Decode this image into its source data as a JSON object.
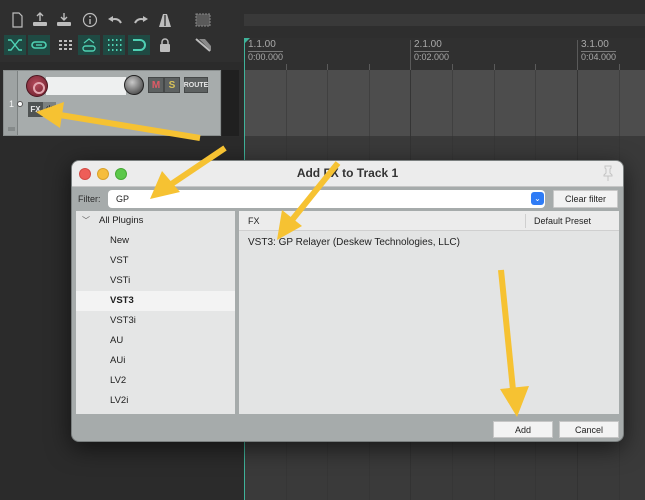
{
  "toolbar": {
    "row1": [
      {
        "icon": "new-project-icon"
      },
      {
        "icon": "save-icon"
      },
      {
        "icon": "open-icon"
      },
      {
        "icon": "info-icon"
      },
      {
        "icon": "undo-icon"
      },
      {
        "icon": "redo-icon"
      },
      {
        "icon": "metronome-icon"
      },
      {
        "icon": "marquee-select-icon"
      }
    ],
    "row2": [
      {
        "icon": "crossfade-icon",
        "active": true
      },
      {
        "icon": "link-icon",
        "active": true
      },
      {
        "icon": "grid-icon",
        "active": false
      },
      {
        "icon": "envelope-link-icon",
        "active": true
      },
      {
        "icon": "snap-grid-icon",
        "active": true
      },
      {
        "icon": "magnet-icon",
        "active": true
      },
      {
        "icon": "lock-icon",
        "active": false
      },
      {
        "icon": "ripple-edit-icon",
        "active": false
      }
    ]
  },
  "track": {
    "number": "1",
    "mute_label": "M",
    "solo_label": "S",
    "route_label": "ROUTE",
    "fx_label": "FX",
    "power_glyph": "⏻"
  },
  "ruler": {
    "markers": [
      {
        "bar": "1.1.00",
        "time": "0:00.000"
      },
      {
        "bar": "2.1.00",
        "time": "0:02.000"
      },
      {
        "bar": "3.1.00",
        "time": "0:04.000"
      }
    ]
  },
  "dialog": {
    "title": "Add FX to Track 1",
    "filter_label": "Filter:",
    "filter_value": "GP",
    "clear_filter_label": "Clear filter",
    "tree": {
      "root_label": "All Plugins",
      "items": [
        "New",
        "VST",
        "VSTi",
        "VST3",
        "VST3i",
        "AU",
        "AUi",
        "LV2",
        "LV2i"
      ],
      "selected": "VST3"
    },
    "columns": {
      "fx": "FX",
      "default_preset": "Default Preset"
    },
    "plugins": [
      {
        "name": "VST3: GP Relayer (Deskew Technologies, LLC)"
      }
    ],
    "add_label": "Add",
    "cancel_label": "Cancel"
  },
  "annotations": {
    "arrow_color": "#f6c232",
    "arrows": [
      {
        "points_to": "fx-button"
      },
      {
        "points_to": "filter-input"
      },
      {
        "points_to": "plugin-row"
      },
      {
        "points_to": "add-button"
      }
    ]
  },
  "colors": {
    "accent_teal": "#4fd1b3",
    "cursor": "#3fb39a",
    "record": "#8a2a3a",
    "mute": "#e05a66",
    "solo": "#d8c25a"
  }
}
